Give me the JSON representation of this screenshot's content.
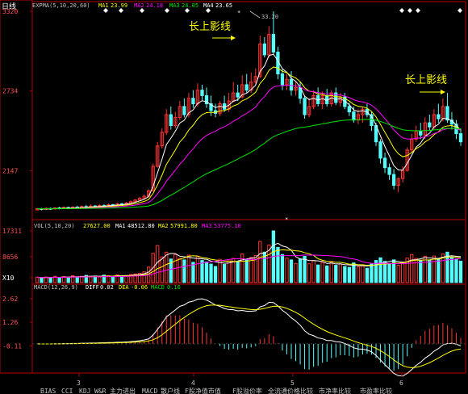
{
  "header": {
    "period": "日线",
    "expma": "EXPMA(5,10,20,60)",
    "ma1_label": "MA1",
    "ma1_value": "23.99",
    "ma2_label": "MA2",
    "ma2_value": "24.18",
    "ma3_label": "MA3",
    "ma3_value": "24.05",
    "ma4_label": "MA4",
    "ma4_value": "23.65",
    "peak_label": "33.20"
  },
  "annotations": {
    "left": "长上影线",
    "right": "长上影线"
  },
  "vol_header": {
    "title": "VOL(5,10,20)",
    "vol": "27627.00",
    "ma1_label": "MA1",
    "ma1_value": "48512.80",
    "ma2_label": "MA2",
    "ma2_value": "57991.80",
    "ma3_label": "MA3",
    "ma3_value": "53775.10"
  },
  "macd_header": {
    "title": "MACD(12,26,9)",
    "diff_label": "DIFF",
    "diff_value": "0.02",
    "dea_label": "DEA",
    "dea_value": "-0.06",
    "macd_label": "MACD",
    "macd_value": "0.16"
  },
  "bottom_tabs": [
    "BIAS",
    "CCI",
    "KDJ",
    "W&R",
    "主力进出",
    "MACD",
    "散户线",
    "F股净值市值",
    "F股溢价率",
    "全流通价格比较",
    "市净率比较",
    "市盈率比较"
  ],
  "colors": {
    "up": "#ff3232",
    "down": "#54fcfc",
    "ma5": "#ffffff",
    "ma10": "#ffff00",
    "ma20": "#ff00ff",
    "ma60": "#00e600",
    "axis": "#b40000",
    "label": "#ff5050"
  },
  "chart_data": [
    {
      "type": "candlestick",
      "title": "日线",
      "y_ticks": [
        "3320",
        "2734",
        "2147"
      ],
      "x_ticks": [
        "3",
        "4",
        "5",
        "6"
      ],
      "ylim": [
        1800,
        3320
      ],
      "series_names": [
        "MA1",
        "MA2",
        "MA3",
        "MA4"
      ],
      "candles": [
        [
          1860,
          1868,
          1875,
          1855
        ],
        [
          1868,
          1862,
          1874,
          1856
        ],
        [
          1862,
          1870,
          1878,
          1858
        ],
        [
          1870,
          1866,
          1876,
          1860
        ],
        [
          1866,
          1874,
          1880,
          1862
        ],
        [
          1874,
          1870,
          1882,
          1864
        ],
        [
          1870,
          1878,
          1885,
          1866
        ],
        [
          1878,
          1872,
          1884,
          1866
        ],
        [
          1872,
          1880,
          1888,
          1868
        ],
        [
          1880,
          1876,
          1890,
          1870
        ],
        [
          1876,
          1884,
          1892,
          1872
        ],
        [
          1884,
          1880,
          1896,
          1874
        ],
        [
          1880,
          1888,
          1900,
          1876
        ],
        [
          1888,
          1884,
          1896,
          1878
        ],
        [
          1884,
          1892,
          1902,
          1880
        ],
        [
          1892,
          1888,
          1900,
          1882
        ],
        [
          1888,
          1898,
          1906,
          1884
        ],
        [
          1898,
          1894,
          1904,
          1888
        ],
        [
          1894,
          1904,
          1912,
          1890
        ],
        [
          1904,
          1900,
          1912,
          1894
        ],
        [
          1900,
          1910,
          1918,
          1896
        ],
        [
          1910,
          1920,
          1930,
          1904
        ],
        [
          1920,
          1932,
          1940,
          1914
        ],
        [
          1932,
          1946,
          1956,
          1926
        ],
        [
          1946,
          1960,
          1972,
          1940
        ],
        [
          1960,
          2000,
          2010,
          1950
        ],
        [
          2000,
          2180,
          2200,
          1995
        ],
        [
          2180,
          2330,
          2360,
          2170
        ],
        [
          2330,
          2430,
          2460,
          2310
        ],
        [
          2430,
          2560,
          2600,
          2410
        ],
        [
          2560,
          2480,
          2620,
          2450
        ],
        [
          2480,
          2540,
          2580,
          2460
        ],
        [
          2540,
          2620,
          2660,
          2520
        ],
        [
          2620,
          2560,
          2680,
          2540
        ],
        [
          2560,
          2680,
          2720,
          2540
        ],
        [
          2680,
          2640,
          2740,
          2610
        ],
        [
          2640,
          2740,
          2790,
          2620
        ],
        [
          2740,
          2700,
          2780,
          2660
        ],
        [
          2700,
          2640,
          2760,
          2610
        ],
        [
          2640,
          2590,
          2700,
          2550
        ],
        [
          2590,
          2570,
          2640,
          2540
        ],
        [
          2570,
          2640,
          2660,
          2550
        ],
        [
          2640,
          2600,
          2700,
          2580
        ],
        [
          2600,
          2660,
          2720,
          2580
        ],
        [
          2660,
          2720,
          2800,
          2650
        ],
        [
          2720,
          2690,
          2780,
          2660
        ],
        [
          2690,
          2780,
          2850,
          2680
        ],
        [
          2780,
          2740,
          2860,
          2720
        ],
        [
          2740,
          2800,
          2870,
          2720
        ],
        [
          2800,
          2840,
          2900,
          2780
        ],
        [
          2840,
          3080,
          3140,
          2830
        ],
        [
          3080,
          3000,
          3130,
          2980
        ],
        [
          3000,
          3150,
          3210,
          2980
        ],
        [
          3150,
          3020,
          3320,
          3000
        ],
        [
          3020,
          2860,
          3060,
          2820
        ],
        [
          2860,
          2780,
          2900,
          2740
        ],
        [
          2780,
          2820,
          2860,
          2740
        ],
        [
          2820,
          2740,
          2880,
          2700
        ],
        [
          2740,
          2760,
          2800,
          2700
        ],
        [
          2760,
          2680,
          2800,
          2640
        ],
        [
          2680,
          2560,
          2700,
          2530
        ],
        [
          2560,
          2620,
          2680,
          2540
        ],
        [
          2620,
          2700,
          2740,
          2600
        ],
        [
          2700,
          2640,
          2760,
          2620
        ],
        [
          2640,
          2700,
          2730,
          2600
        ],
        [
          2700,
          2640,
          2750,
          2620
        ],
        [
          2640,
          2720,
          2740,
          2620
        ],
        [
          2720,
          2650,
          2760,
          2630
        ],
        [
          2650,
          2690,
          2720,
          2620
        ],
        [
          2690,
          2620,
          2720,
          2600
        ],
        [
          2620,
          2580,
          2650,
          2550
        ],
        [
          2580,
          2520,
          2620,
          2500
        ],
        [
          2520,
          2560,
          2600,
          2490
        ],
        [
          2560,
          2600,
          2620,
          2500
        ],
        [
          2600,
          2560,
          2640,
          2540
        ],
        [
          2560,
          2480,
          2580,
          2440
        ],
        [
          2480,
          2360,
          2500,
          2330
        ],
        [
          2360,
          2240,
          2380,
          2200
        ],
        [
          2240,
          2170,
          2280,
          2130
        ],
        [
          2170,
          2120,
          2200,
          2080
        ],
        [
          2120,
          2040,
          2160,
          2010
        ],
        [
          2040,
          2090,
          2100,
          1990
        ],
        [
          2090,
          2150,
          2180,
          2060
        ],
        [
          2150,
          2300,
          2320,
          2140
        ],
        [
          2300,
          2380,
          2420,
          2280
        ],
        [
          2380,
          2440,
          2480,
          2360
        ],
        [
          2440,
          2410,
          2500,
          2380
        ],
        [
          2410,
          2500,
          2540,
          2380
        ],
        [
          2500,
          2470,
          2560,
          2440
        ],
        [
          2470,
          2560,
          2600,
          2450
        ],
        [
          2560,
          2530,
          2640,
          2500
        ],
        [
          2530,
          2620,
          2680,
          2510
        ],
        [
          2620,
          2520,
          2720,
          2500
        ],
        [
          2520,
          2490,
          2580,
          2450
        ],
        [
          2490,
          2420,
          2520,
          2380
        ],
        [
          2420,
          2360,
          2460,
          2330
        ]
      ]
    },
    {
      "type": "bar",
      "title": "VOL(5,10,20)",
      "y_ticks": [
        "17311",
        "8656",
        "X10"
      ],
      "ylim": [
        0,
        17311
      ],
      "values": [
        1800,
        1500,
        1900,
        1600,
        2100,
        1700,
        2000,
        1800,
        2300,
        1900,
        2100,
        2400,
        2000,
        2200,
        1900,
        2500,
        2300,
        2100,
        2600,
        2200,
        2400,
        2700,
        2900,
        3100,
        3600,
        5200,
        9800,
        12400,
        8600,
        10200,
        7900,
        9400,
        8100,
        7600,
        9200,
        6800,
        8700,
        7400,
        6900,
        6200,
        5400,
        7800,
        6100,
        7300,
        8100,
        6900,
        9600,
        7800,
        8400,
        9100,
        13800,
        10200,
        12600,
        17311,
        11800,
        9400,
        8200,
        7600,
        6400,
        7900,
        8800,
        6300,
        7400,
        5900,
        6800,
        5600,
        7100,
        5800,
        6200,
        5400,
        5100,
        6600,
        5300,
        5900,
        4800,
        6200,
        7400,
        8300,
        7100,
        6400,
        7600,
        5800,
        6900,
        8200,
        9400,
        8100,
        7300,
        8800,
        7600,
        8900,
        7800,
        9600,
        10200,
        8400,
        7900,
        7200
      ],
      "up": [
        1,
        0,
        1,
        0,
        1,
        0,
        1,
        0,
        1,
        0,
        1,
        0,
        1,
        0,
        1,
        0,
        1,
        0,
        1,
        0,
        1,
        1,
        1,
        1,
        1,
        1,
        1,
        1,
        1,
        1,
        0,
        1,
        1,
        0,
        1,
        0,
        1,
        0,
        0,
        0,
        0,
        1,
        0,
        1,
        1,
        0,
        1,
        0,
        1,
        1,
        1,
        0,
        1,
        0,
        0,
        0,
        1,
        0,
        1,
        0,
        0,
        1,
        1,
        0,
        1,
        0,
        1,
        0,
        1,
        0,
        0,
        0,
        1,
        1,
        0,
        0,
        0,
        0,
        0,
        0,
        0,
        1,
        1,
        1,
        1,
        1,
        0,
        1,
        0,
        1,
        0,
        1,
        0,
        0,
        0,
        0
      ]
    },
    {
      "type": "line",
      "title": "MACD(12,26,9)",
      "y_ticks": [
        "2.62",
        "1.26",
        "-0.11"
      ],
      "ylim": [
        -1.6,
        3.0
      ],
      "series_names": [
        "DIFF",
        "DEA",
        "MACD"
      ]
    }
  ]
}
